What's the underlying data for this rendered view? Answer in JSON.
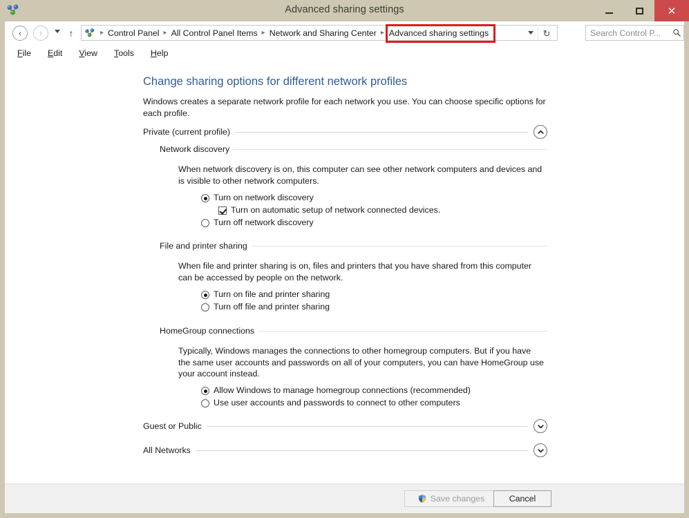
{
  "window": {
    "title": "Advanced sharing settings",
    "app_icon": "network-icon",
    "controls": {
      "minimize": "minimize-icon",
      "maximize": "maximize-icon",
      "close": "close-icon",
      "close_glyph": "✕"
    }
  },
  "navbar": {
    "back": "‹",
    "forward": "›",
    "up": "↑",
    "refresh": "↻",
    "breadcrumbs": [
      "Control Panel",
      "All Control Panel Items",
      "Network and Sharing Center"
    ],
    "separator": "▸",
    "current_location": "Advanced sharing settings",
    "search": {
      "placeholder": "Search Control P...",
      "icon": "🔍"
    }
  },
  "menubar": {
    "items": [
      {
        "accel": "F",
        "rest": "ile"
      },
      {
        "accel": "E",
        "rest": "dit"
      },
      {
        "accel": "V",
        "rest": "iew"
      },
      {
        "accel": "T",
        "rest": "ools"
      },
      {
        "accel": "H",
        "rest": "elp"
      }
    ]
  },
  "page": {
    "title": "Change sharing options for different network profiles",
    "description": "Windows creates a separate network profile for each network you use. You can choose specific options for each profile."
  },
  "profiles": {
    "private": {
      "label": "Private (current profile)",
      "expanded_chevron": "▲",
      "network_discovery": {
        "heading": "Network discovery",
        "paragraph": "When network discovery is on, this computer can see other network computers and devices and is visible to other network computers.",
        "option_on": "Turn on network discovery",
        "option_auto_setup": "Turn on automatic setup of network connected devices.",
        "option_off": "Turn off network discovery"
      },
      "file_printer_sharing": {
        "heading": "File and printer sharing",
        "paragraph": "When file and printer sharing is on, files and printers that you have shared from this computer can be accessed by people on the network.",
        "option_on": "Turn on file and printer sharing",
        "option_off": "Turn off file and printer sharing"
      },
      "homegroup": {
        "heading": "HomeGroup connections",
        "paragraph": "Typically, Windows manages the connections to other homegroup computers. But if you have the same user accounts and passwords on all of your computers, you can have HomeGroup use your account instead.",
        "option_manage": "Allow Windows to manage homegroup connections (recommended)",
        "option_accounts": "Use user accounts and passwords to connect to other computers"
      }
    },
    "guest_or_public": {
      "label": "Guest or Public",
      "collapsed_chevron": "▼"
    },
    "all_networks": {
      "label": "All Networks",
      "collapsed_chevron": "▼"
    }
  },
  "footer": {
    "save_label": "Save changes",
    "save_icon": "uac-shield-icon",
    "cancel_label": "Cancel"
  },
  "colors": {
    "titlebar": "#cec8b2",
    "close_button": "#cc4a4a",
    "heading_blue": "#2f5c9e",
    "annotation_red": "#e01b1b",
    "footer": "#f0f0f0"
  }
}
